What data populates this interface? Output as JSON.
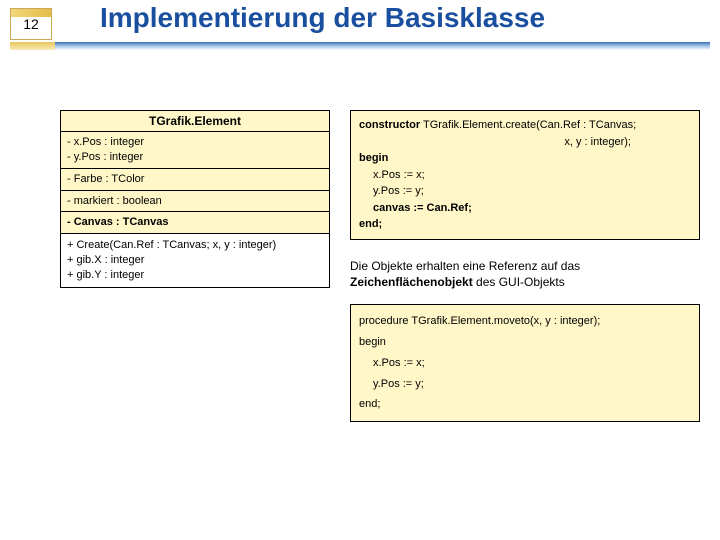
{
  "slide_number": "12",
  "title": "Implementierung der Basisklasse",
  "uml": {
    "class_name": "TGrafik.Element",
    "sec1a": "- x.Pos : integer",
    "sec1b": "- y.Pos : integer",
    "sec2": "- Farbe : TColor",
    "sec3": "- markiert : boolean",
    "sec4": "- Canvas : TCanvas",
    "meth1": "+ Create(Can.Ref : TCanvas; x, y : integer)",
    "meth2": "+ gib.X : integer",
    "meth3": "+ gib.Y : integer"
  },
  "code1": {
    "kw_constructor": "constructor",
    "sig": " TGrafik.Element.create(Can.Ref : TCanvas;",
    "sig2": "x, y : integer);",
    "kw_begin": "begin",
    "l1": "x.Pos := x;",
    "l2": "y.Pos := y;",
    "l3": "canvas := Can.Ref;",
    "kw_end": "end;"
  },
  "note_plain": "Die Objekte erhalten eine Referenz auf das ",
  "note_bold": "Zeichenflächenobjekt",
  "note_tail": " des GUI-Objekts",
  "code2": {
    "kw_procedure": "procedure",
    "sig": " TGrafik.Element.moveto(x, y : integer);",
    "kw_begin": "begin",
    "l1": "x.Pos := x;",
    "l2": "y.Pos := y;",
    "kw_end": "end;"
  }
}
